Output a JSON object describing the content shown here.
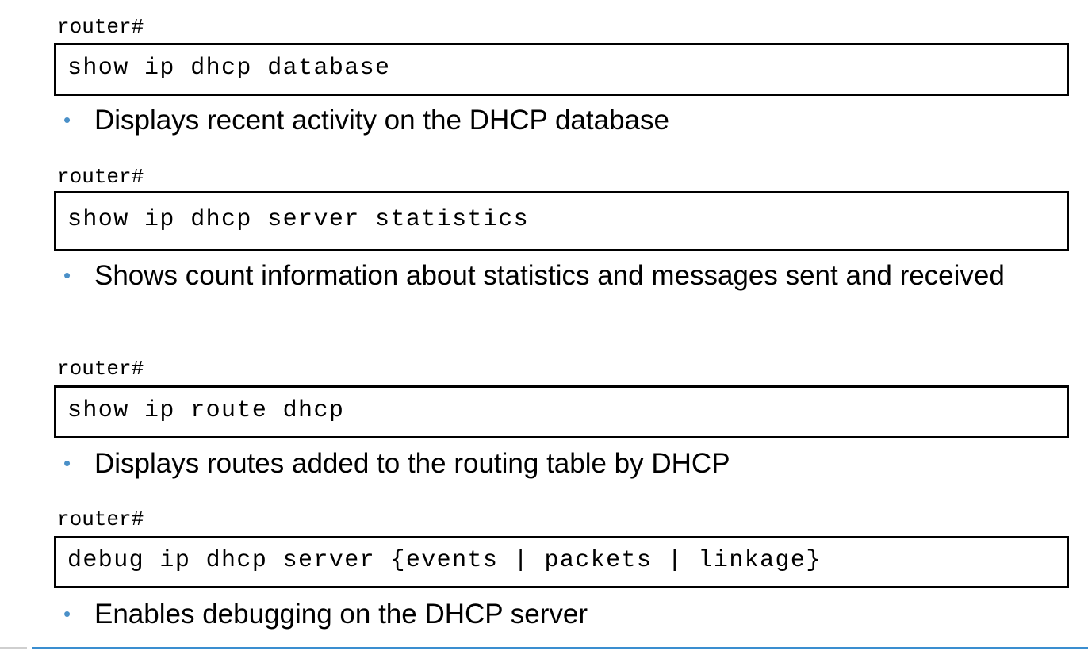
{
  "colors": {
    "bullet": "#4a90c8",
    "footer_line": "#3a8ed0",
    "box_border": "#000000"
  },
  "blocks": [
    {
      "prompt": "router#",
      "command": "show ip dhcp database",
      "description": "Displays recent activity on the DHCP database"
    },
    {
      "prompt": "router#",
      "command": "show ip dhcp server statistics",
      "description": "Shows count information about statistics and messages sent and received"
    },
    {
      "prompt": "router#",
      "command": "show ip route dhcp",
      "description": "Displays routes added to the routing table by DHCP"
    },
    {
      "prompt": "router#",
      "command": "debug ip dhcp server {events | packets | linkage}",
      "description": "Enables debugging on the DHCP server"
    }
  ]
}
